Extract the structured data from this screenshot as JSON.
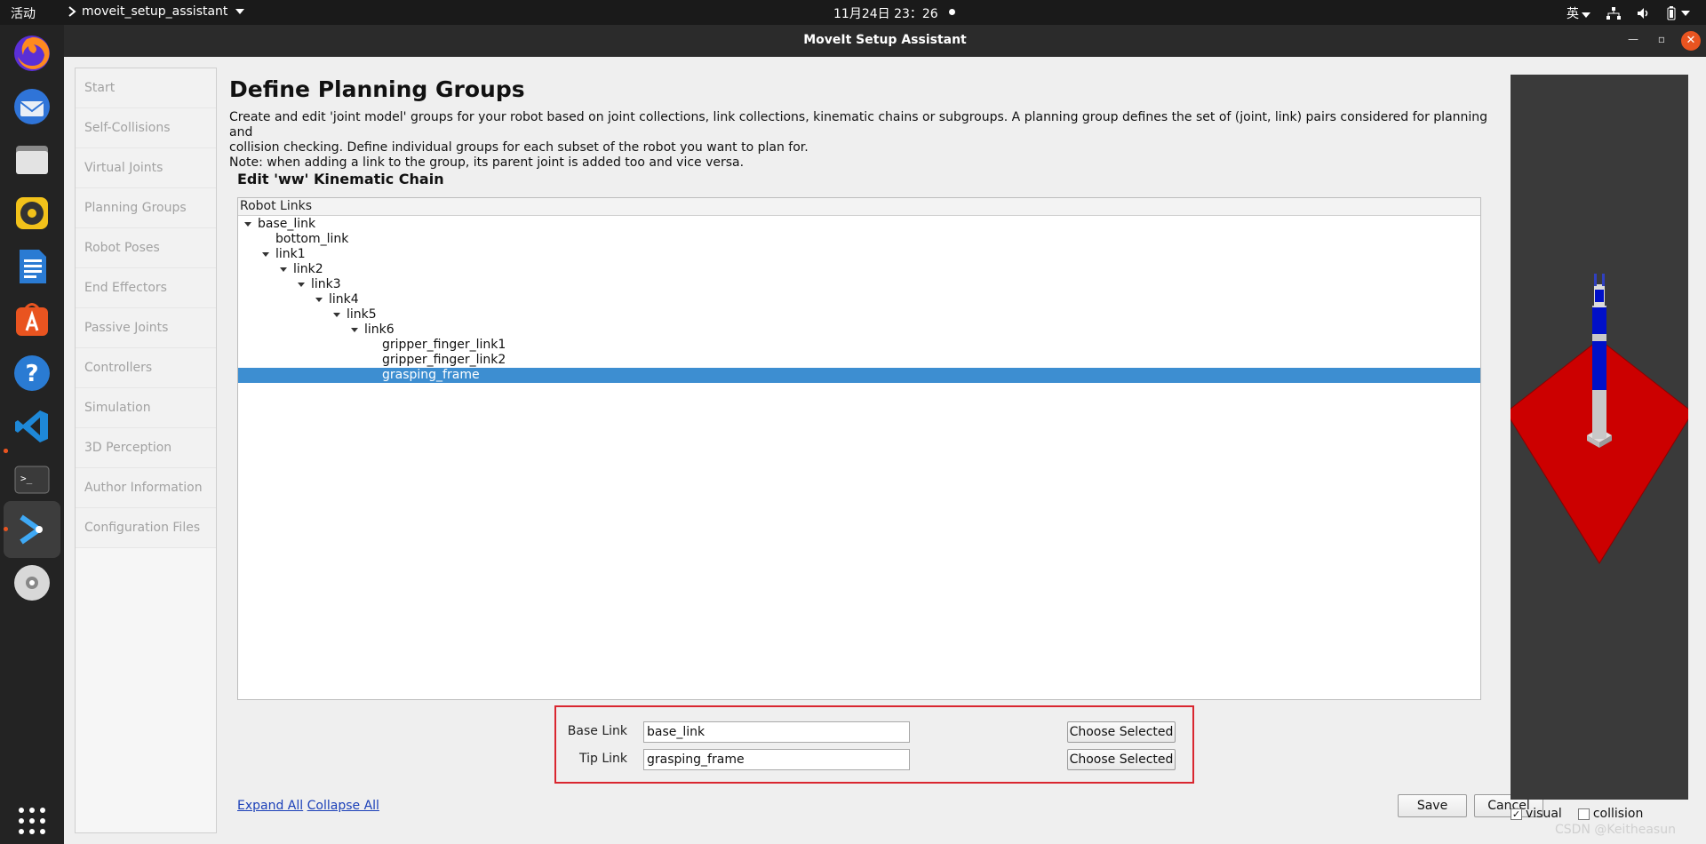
{
  "topbar": {
    "activities": "活动",
    "app_menu": "moveit_setup_assistant",
    "clock": "11月24日  23：26",
    "input_method": "英"
  },
  "window": {
    "title": "MoveIt Setup Assistant"
  },
  "nav": {
    "items": [
      {
        "label": "Start"
      },
      {
        "label": "Self-Collisions"
      },
      {
        "label": "Virtual Joints"
      },
      {
        "label": "Planning Groups"
      },
      {
        "label": "Robot Poses"
      },
      {
        "label": "End Effectors"
      },
      {
        "label": "Passive Joints"
      },
      {
        "label": "Controllers"
      },
      {
        "label": "Simulation"
      },
      {
        "label": "3D Perception"
      },
      {
        "label": "Author Information"
      },
      {
        "label": "Configuration Files"
      }
    ]
  },
  "main": {
    "title": "Define Planning Groups",
    "description_line1": "Create and edit 'joint model' groups for your robot based on joint collections, link collections, kinematic chains or subgroups. A planning group defines the set of (joint, link) pairs considered for planning and",
    "description_line2": "collision checking. Define individual groups for each subset of the robot you want to plan for.",
    "description_line3": "Note: when adding a link to the group, its parent joint is added too and vice versa.",
    "section_title": "Edit 'ww' Kinematic Chain"
  },
  "tree": {
    "header": "Robot Links",
    "nodes": [
      {
        "label": "base_link"
      },
      {
        "label": "bottom_link"
      },
      {
        "label": "link1"
      },
      {
        "label": "link2"
      },
      {
        "label": "link3"
      },
      {
        "label": "link4"
      },
      {
        "label": "link5"
      },
      {
        "label": "link6"
      },
      {
        "label": "gripper_finger_link1"
      },
      {
        "label": "gripper_finger_link2"
      },
      {
        "label": "grasping_frame"
      }
    ],
    "selected": "grasping_frame"
  },
  "chain": {
    "base_label": "Base Link",
    "base_value": "base_link",
    "tip_label": "Tip Link",
    "tip_value": "grasping_frame",
    "choose_label": "Choose Selected"
  },
  "actions": {
    "expand_all": "Expand All",
    "collapse_all": "Collapse All",
    "save": "Save",
    "cancel": "Cancel"
  },
  "view": {
    "visual_label": "visual",
    "visual_checked": true,
    "collision_label": "collision",
    "collision_checked": false
  },
  "watermark": "CSDN @Keitheasun",
  "colors": {
    "selection": "#3d8ed1",
    "highlight_border": "#d9262f",
    "floor": "#cc0000",
    "robot_body": "#0010c8",
    "link_color": "#1a3fb8"
  }
}
